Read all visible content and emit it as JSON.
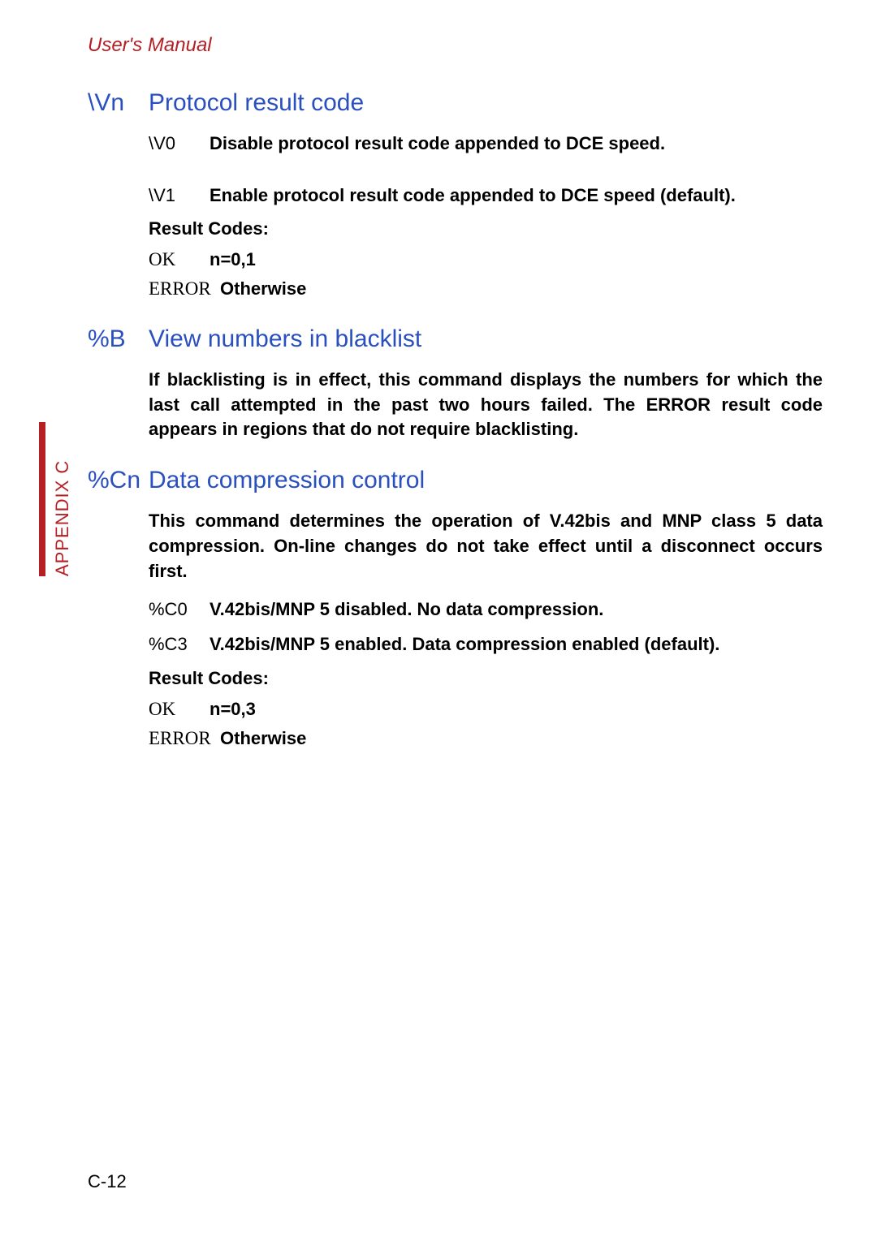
{
  "header": "User's Manual",
  "side_tab": "APPENDIX C",
  "footer": "C-12",
  "sections": [
    {
      "cmd": "\\Vn",
      "title": "Protocol result code",
      "items": [
        {
          "code": "\\V0",
          "code_style": "sans",
          "desc": "Disable protocol result code appended to DCE speed."
        },
        {
          "code": "\\V1",
          "code_style": "sans",
          "desc": "Enable protocol result code appended to DCE speed (default)."
        }
      ],
      "result_label": "Result Codes:",
      "results": [
        {
          "code": "OK",
          "code_style": "serif",
          "desc": "n=0,1"
        },
        {
          "code": "ERROR",
          "code_style": "serif",
          "desc": "Otherwise"
        }
      ]
    },
    {
      "cmd": "%B",
      "title": "View numbers in blacklist",
      "para": "If blacklisting is in effect, this command displays the numbers for which the last call attempted in the past two hours failed. The ERROR result code appears in regions that do not require blacklisting."
    },
    {
      "cmd": "%Cn",
      "title": "Data compression control",
      "para": "This command determines the operation of V.42bis and MNP class 5 data compression. On-line changes do not take effect until a disconnect occurs first.",
      "items": [
        {
          "code": "%C0",
          "code_style": "sans",
          "desc": "V.42bis/MNP 5 disabled. No data compression."
        },
        {
          "code": "%C3",
          "code_style": "sans",
          "desc": "V.42bis/MNP 5 enabled. Data compression enabled (default)."
        }
      ],
      "result_label": "Result Codes:",
      "results": [
        {
          "code": "OK",
          "code_style": "serif",
          "desc": "n=0,3"
        },
        {
          "code": "ERROR",
          "code_style": "serif",
          "desc": "Otherwise"
        }
      ]
    }
  ]
}
